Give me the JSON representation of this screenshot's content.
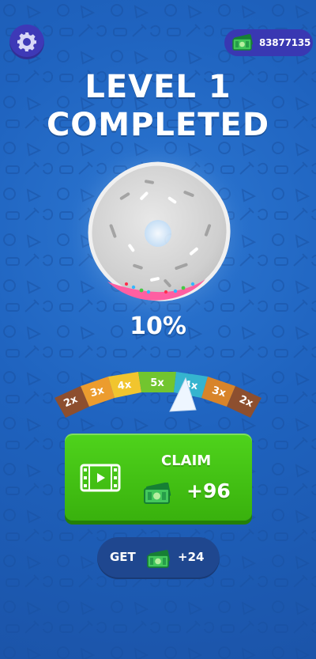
{
  "top_bar": {
    "settings_icon": "gear-icon",
    "currency_icon": "cash-icon",
    "currency_amount": "83877135"
  },
  "result": {
    "title_line_1": "LEVEL 1",
    "title_line_2": "COMPLETED",
    "progress_text": "10%",
    "progress_percent": 10
  },
  "multiplier_meter": {
    "segments": [
      "2x",
      "3x",
      "4x",
      "5x",
      "4x",
      "3x",
      "2x"
    ],
    "selected": "4x",
    "colors": [
      "#8d4f2f",
      "#ec9c2e",
      "#f1c52e",
      "#72c52f",
      "#35b4cf",
      "#d8842a",
      "#8d4f2f"
    ]
  },
  "claim_button": {
    "label": "CLAIM",
    "amount": "+96",
    "video_icon": "video-icon",
    "money_icon": "cash-icon"
  },
  "get_button": {
    "label": "GET",
    "amount": "+24",
    "money_icon": "cash-icon"
  },
  "colors": {
    "background": "#1f63bf",
    "settings_button": "#3e39b7",
    "claim_button": "#42c214",
    "currency_pill": "#3938b2"
  }
}
